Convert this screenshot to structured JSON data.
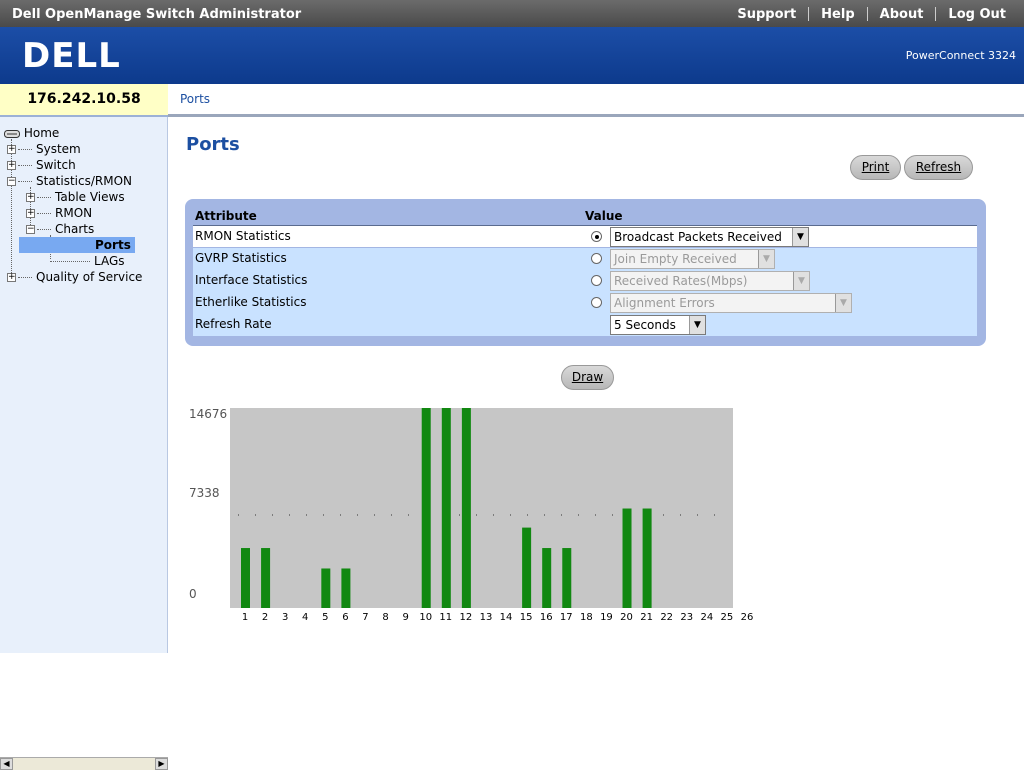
{
  "app": {
    "title": "Dell OpenManage Switch Administrator",
    "links": [
      "Support",
      "Help",
      "About",
      "Log Out"
    ],
    "logo_text": "DELL",
    "model": "PowerConnect 3324",
    "ip": "176.242.10.58",
    "breadcrumb": "Ports"
  },
  "sidebar": {
    "items": [
      {
        "label": "Home"
      },
      {
        "label": "System"
      },
      {
        "label": "Switch"
      },
      {
        "label": "Statistics/RMON"
      },
      {
        "label": "Table Views"
      },
      {
        "label": "RMON"
      },
      {
        "label": "Charts"
      },
      {
        "label": "Ports"
      },
      {
        "label": "LAGs"
      },
      {
        "label": "Quality of Service"
      }
    ]
  },
  "main": {
    "title": "Ports",
    "print_label": "Print",
    "refresh_label": "Refresh",
    "draw_label": "Draw",
    "table": {
      "col_attribute": "Attribute",
      "col_value": "Value",
      "rows": [
        {
          "label": "RMON Statistics",
          "value": "Broadcast Packets Received",
          "selected": true,
          "enabled": true
        },
        {
          "label": "GVRP Statistics",
          "value": "Join Empty Received",
          "selected": false,
          "enabled": false
        },
        {
          "label": "Interface Statistics",
          "value": "Received Rates(Mbps)",
          "selected": false,
          "enabled": false
        },
        {
          "label": "Etherlike Statistics",
          "value": "Alignment Errors",
          "selected": false,
          "enabled": false
        },
        {
          "label": "Refresh Rate",
          "value": "5 Seconds",
          "enabled": true
        }
      ]
    }
  },
  "chart_data": {
    "type": "bar",
    "categories": [
      "1",
      "2",
      "3",
      "4",
      "5",
      "6",
      "7",
      "8",
      "9",
      "10",
      "11",
      "12",
      "13",
      "14",
      "15",
      "16",
      "17",
      "18",
      "19",
      "20",
      "21",
      "22",
      "23",
      "24",
      "25",
      "26"
    ],
    "values": [
      4400,
      4400,
      0,
      0,
      2900,
      2900,
      0,
      0,
      0,
      14676,
      14676,
      14676,
      0,
      0,
      5900,
      4400,
      4400,
      0,
      0,
      7300,
      7300,
      0,
      0,
      0,
      0,
      0
    ],
    "yticks": [
      "14676",
      "7338",
      "0"
    ],
    "ylim": [
      0,
      14676
    ],
    "bar_color": "#118811",
    "plot_bg": "#c6c6c6",
    "reference_line": 7338
  },
  "colors": {
    "topbar": "#4a4a4a",
    "brand": "#1c4ea7",
    "link_blue": "#1c4fa1",
    "panel": "#a3b6e3",
    "selected_node": "#78a9f1"
  }
}
